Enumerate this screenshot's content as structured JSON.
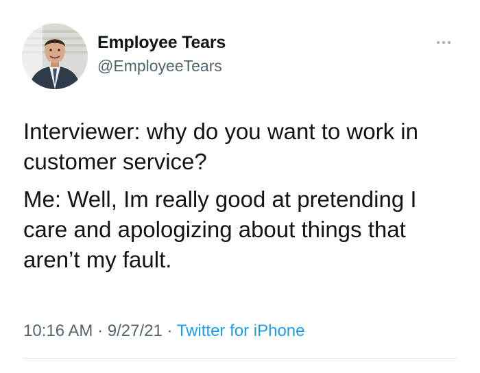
{
  "user": {
    "display_name": "Employee Tears",
    "handle": "@EmployeeTears",
    "avatar_icon": "profile-photo"
  },
  "tweet": {
    "paragraphs": [
      "Interviewer: why do you want to work in customer service?",
      "Me: Well, Im really good at pretending I care and apologizing about things that aren’t my fault."
    ],
    "time": "10:16 AM",
    "date": "9/27/21",
    "separator": "·",
    "source": "Twitter for iPhone"
  },
  "icons": {
    "more": "more-options-icon"
  },
  "colors": {
    "link": "#1d9bf0",
    "secondary_text": "#536471",
    "primary_text": "#0f1419"
  }
}
